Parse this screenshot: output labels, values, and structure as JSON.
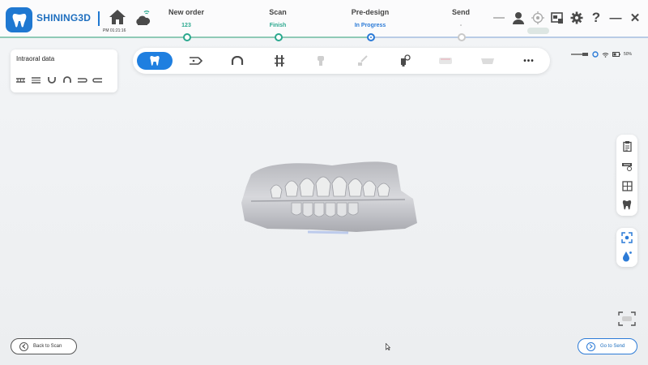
{
  "header": {
    "brand": "SHINING3D",
    "time": "PM 01:21:16",
    "steps": [
      {
        "title": "New order",
        "sub": "123",
        "state": "done"
      },
      {
        "title": "Scan",
        "sub": "Finish",
        "state": "done"
      },
      {
        "title": "Pre-design",
        "sub": "In Progress",
        "state": "active"
      },
      {
        "title": "Send",
        "sub": "-",
        "state": "pending"
      }
    ],
    "icons": [
      "menu-icon",
      "user-icon",
      "target-icon",
      "screenshot-icon",
      "gear-icon",
      "help-icon",
      "minimize-icon",
      "close-icon"
    ],
    "help_glyph": "?",
    "min_glyph": "—",
    "close_glyph": "✕"
  },
  "left_panel": {
    "title": "Intraoral data",
    "icons": [
      "upper-jaw-view-icon",
      "both-jaws-view-icon",
      "lower-arch-icon",
      "upper-arch-icon",
      "occlusion-left-icon",
      "occlusion-right-icon"
    ]
  },
  "toolbar": {
    "items": [
      "tooth-select-icon",
      "trim-tool-icon",
      "arch-icon",
      "margin-line-icon",
      "tooth-prep-icon",
      "brush-tool-icon",
      "scanbody-icon",
      "gingiva-icon",
      "base-icon",
      "more-icon"
    ],
    "active_index": 0,
    "more_glyph": "•••"
  },
  "status": {
    "wifi_battery": "50%"
  },
  "right_tools": [
    "order-info-icon",
    "scan-quality-icon",
    "texture-icon",
    "tooth-status-icon"
  ],
  "right_tools2": [
    "snap-icon",
    "color-drop-icon"
  ],
  "footer": {
    "back_label": "Back to Scan",
    "go_label": "Go to Send"
  },
  "colors": {
    "accent": "#1f7fe0",
    "done": "#2aa88e",
    "active": "#2c7bd7",
    "pending": "#999999"
  }
}
